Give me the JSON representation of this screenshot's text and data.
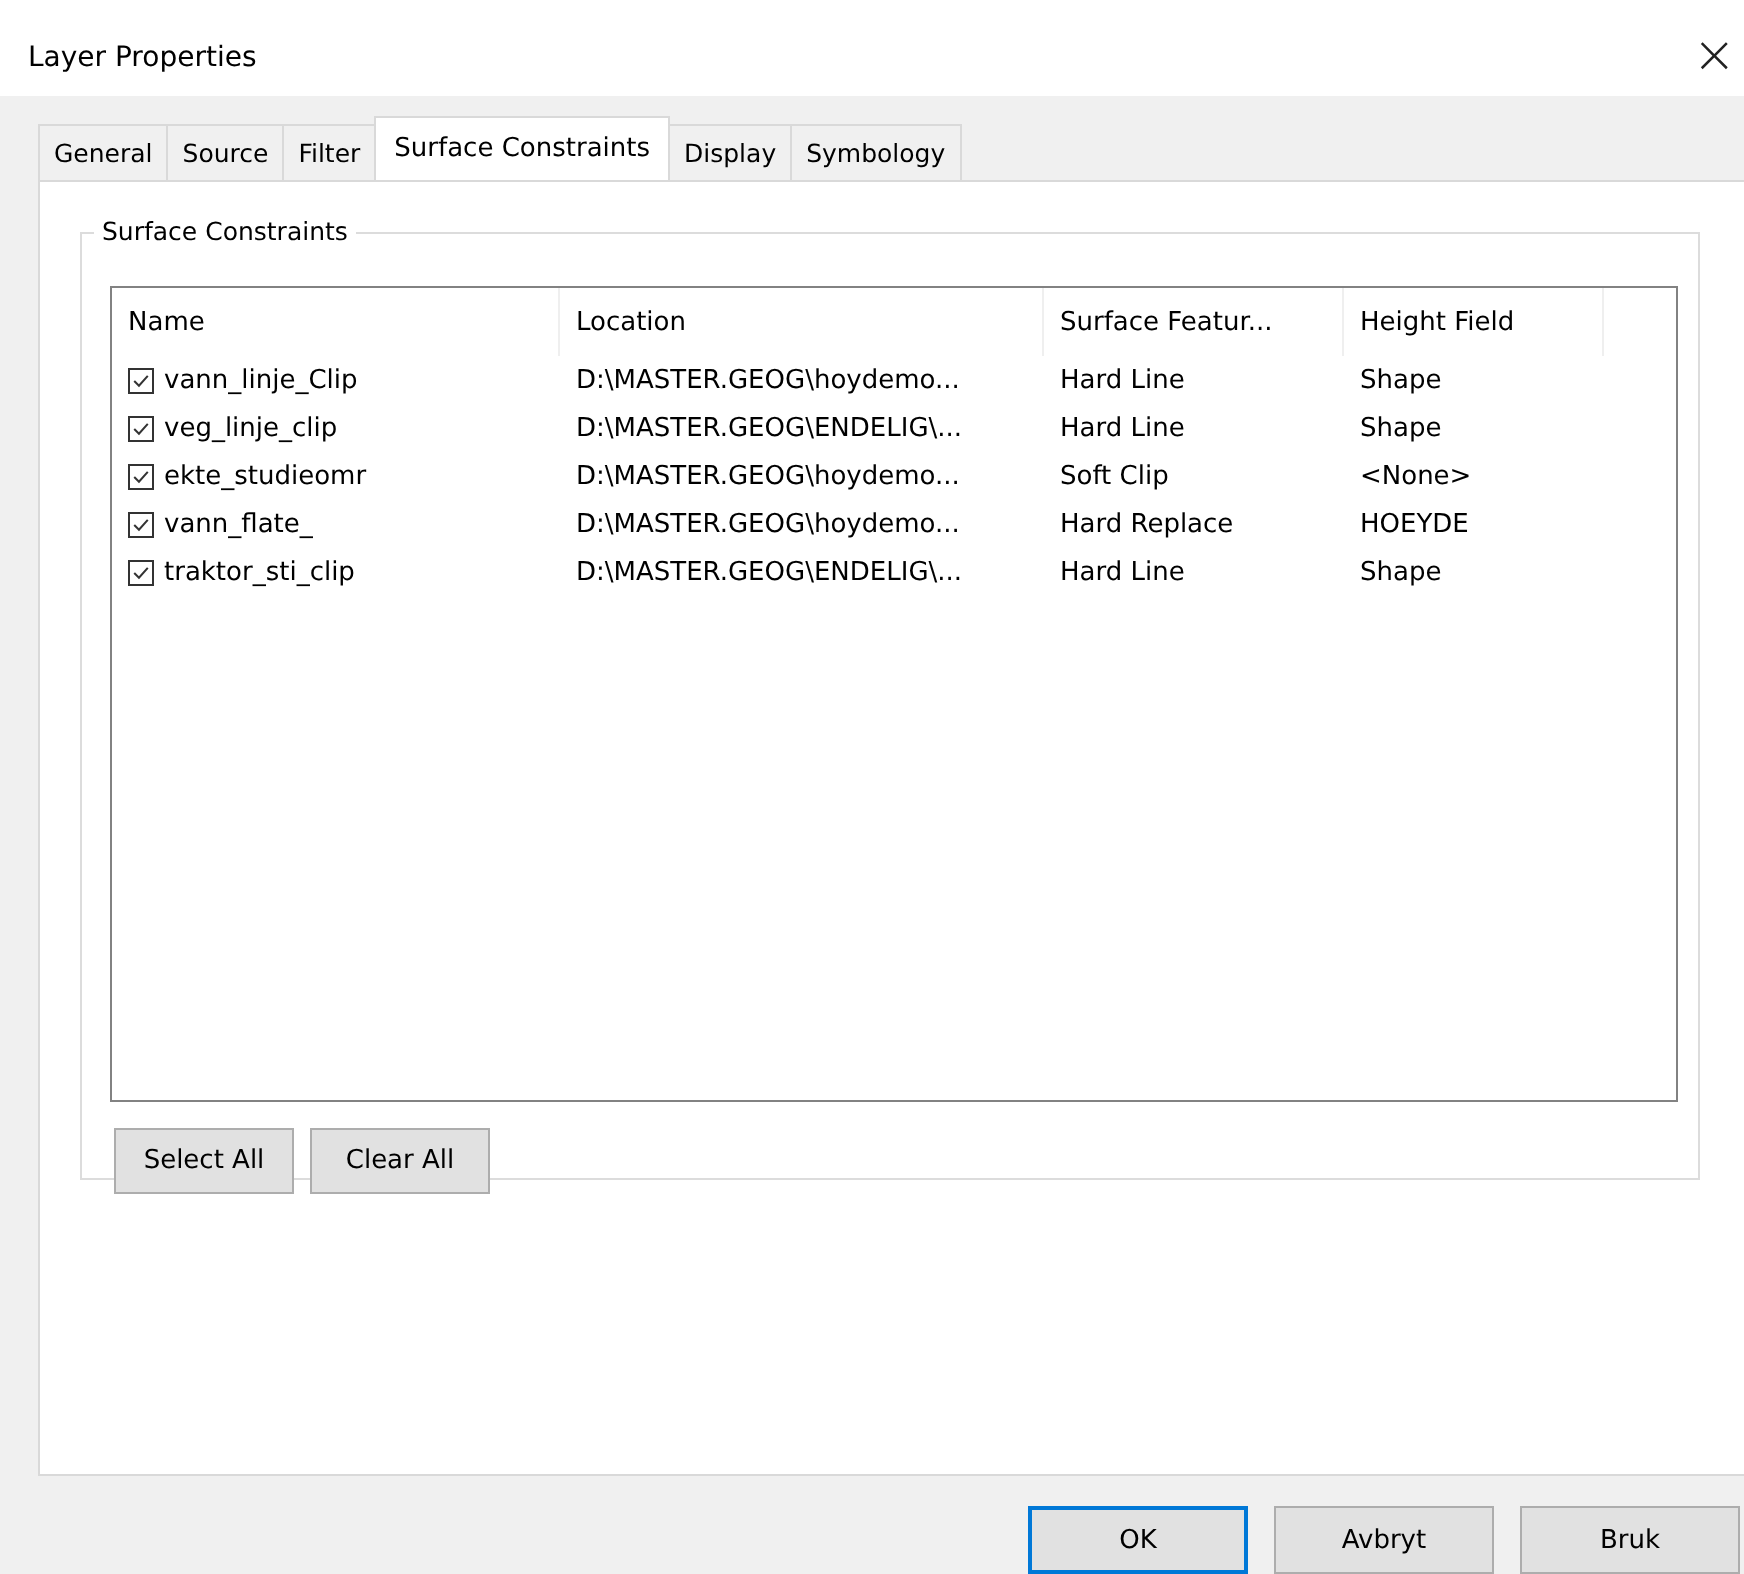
{
  "window": {
    "title": "Layer Properties",
    "close": "×"
  },
  "tabs": [
    {
      "label": "General",
      "selected": false
    },
    {
      "label": "Source",
      "selected": false
    },
    {
      "label": "Filter",
      "selected": false
    },
    {
      "label": "Surface Constraints",
      "selected": true
    },
    {
      "label": "Display",
      "selected": false
    },
    {
      "label": "Symbology",
      "selected": false
    }
  ],
  "group": {
    "title": "Surface Constraints",
    "table": {
      "columns": [
        "Name",
        "Location",
        "Surface Featur...",
        "Height Field"
      ],
      "rows": [
        {
          "checked": true,
          "cells": [
            "vann_linje_Clip",
            "D:\\MASTER.GEOG\\hoydemo...",
            "Hard Line",
            "Shape"
          ]
        },
        {
          "checked": true,
          "cells": [
            "veg_linje_clip",
            "D:\\MASTER.GEOG\\ENDELIG\\...",
            "Hard Line",
            "Shape"
          ]
        },
        {
          "checked": true,
          "cells": [
            "ekte_studieomr",
            "D:\\MASTER.GEOG\\hoydemo...",
            "Soft Clip",
            "<None>"
          ]
        },
        {
          "checked": true,
          "cells": [
            "vann_flate_",
            "D:\\MASTER.GEOG\\hoydemo...",
            "Hard Replace",
            "HOEYDE"
          ]
        },
        {
          "checked": true,
          "cells": [
            "traktor_sti_clip",
            "D:\\MASTER.GEOG\\ENDELIG\\...",
            "Hard Line",
            "Shape"
          ]
        }
      ]
    },
    "buttons": [
      "Select All",
      "Clear All"
    ]
  },
  "dialog_buttons": [
    {
      "label": "OK",
      "default": true
    },
    {
      "label": "Avbryt",
      "default": false
    },
    {
      "label": "Bruk",
      "default": false
    }
  ]
}
